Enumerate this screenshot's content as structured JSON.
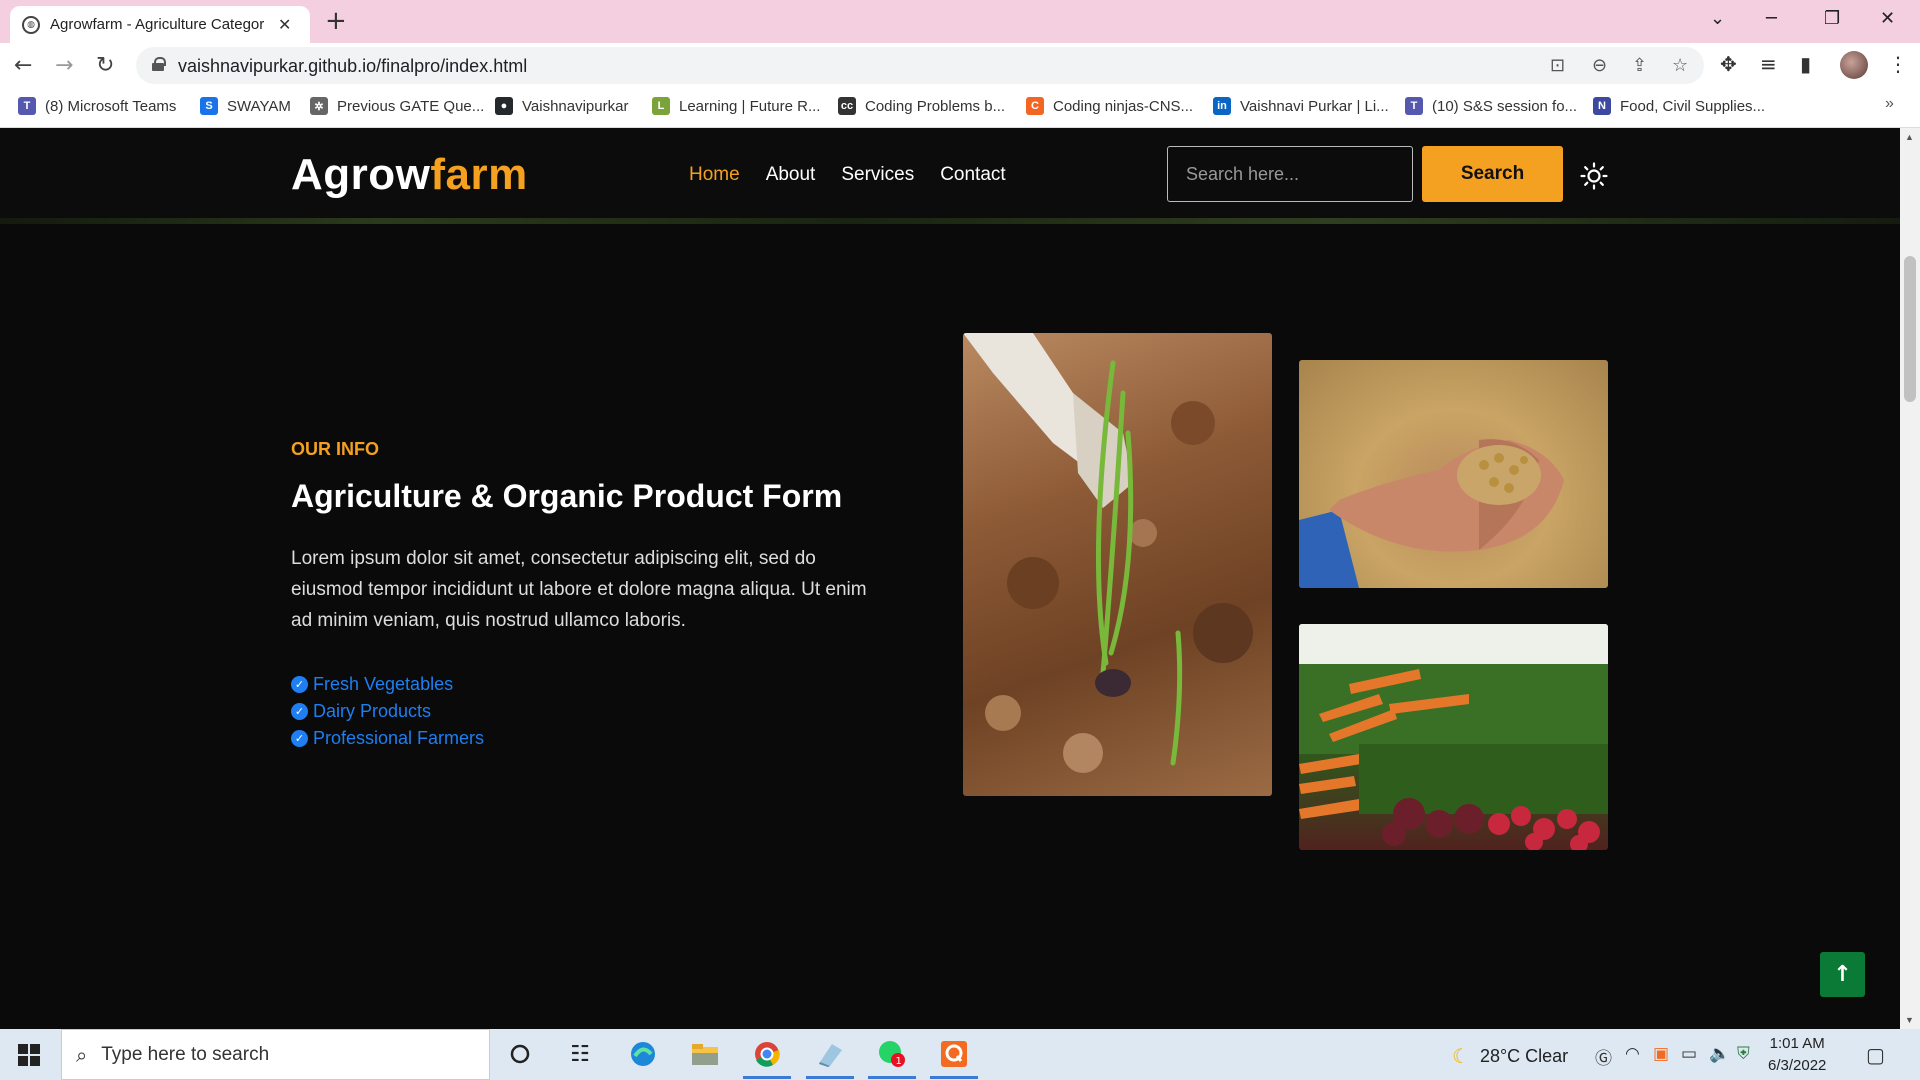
{
  "browser": {
    "tab_title": "Agrowfarm - Agriculture Categor",
    "url": "vaishnavipurkar.github.io/finalpro/index.html",
    "bookmarks": [
      {
        "label": "(8) Microsoft Teams",
        "color": "#5558af",
        "glyph": "T"
      },
      {
        "label": "SWAYAM",
        "color": "#1a73e8",
        "glyph": "S"
      },
      {
        "label": "Previous GATE Que...",
        "color": "#666666",
        "glyph": "✲"
      },
      {
        "label": "Vaishnavipurkar",
        "color": "#24292e",
        "glyph": "●"
      },
      {
        "label": "Learning | Future R...",
        "color": "#7aa33a",
        "glyph": "L"
      },
      {
        "label": "Coding Problems b...",
        "color": "#333333",
        "glyph": "cc"
      },
      {
        "label": "Coding ninjas-CNS...",
        "color": "#f26522",
        "glyph": "C"
      },
      {
        "label": "Vaishnavi Purkar | Li...",
        "color": "#0a66c2",
        "glyph": "in"
      },
      {
        "label": "(10) S&S session fo...",
        "color": "#5558af",
        "glyph": "T"
      },
      {
        "label": "Food, Civil Supplies...",
        "color": "#3b4aa0",
        "glyph": "N"
      }
    ]
  },
  "site": {
    "logo_part1": "Agrow",
    "logo_part2": "farm",
    "nav": [
      "Home",
      "About",
      "Services",
      "Contact"
    ],
    "active_nav": "Home",
    "search_placeholder": "Search here...",
    "search_button": "Search",
    "accent_color": "#f4a020"
  },
  "info": {
    "tag": "OUR INFO",
    "title": "Agriculture & Organic Product Form",
    "text": "Lorem ipsum dolor sit amet, consectetur adipiscing elit, sed do eiusmod tempor incididunt ut labore et dolore magna aliqua. Ut enim ad minim veniam, quis nostrud ullamco laboris.",
    "features": [
      "Fresh Vegetables",
      "Dairy Products",
      "Professional Farmers"
    ]
  },
  "images": [
    {
      "name": "photo-planting-soil",
      "subject": "hand planting onion seedling in soil"
    },
    {
      "name": "photo-grain-hand",
      "subject": "hand holding grain"
    },
    {
      "name": "photo-vegetables",
      "subject": "carrots and radishes at market"
    }
  ],
  "taskbar": {
    "search_placeholder": "Type here to search",
    "weather": "28°C  Clear",
    "time": "1:01 AM",
    "date": "6/3/2022"
  }
}
